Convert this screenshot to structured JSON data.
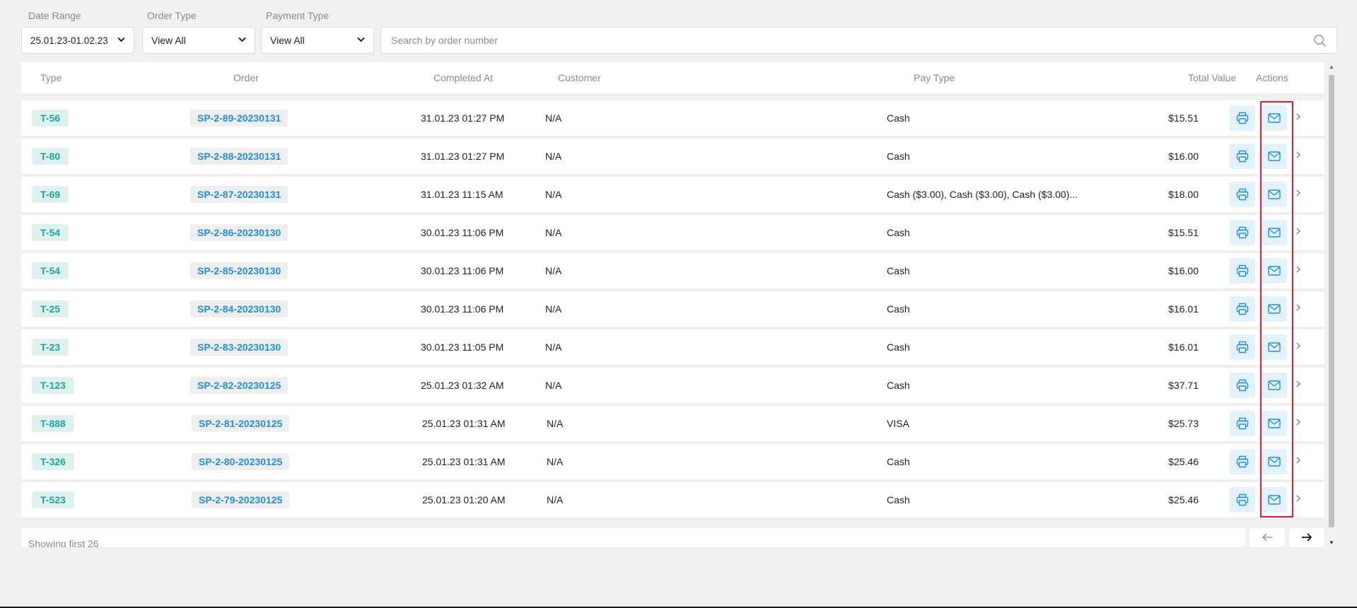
{
  "filters": {
    "date_range": {
      "label": "Date Range",
      "value": "25.01.23-01.02.23"
    },
    "order_type": {
      "label": "Order Type",
      "value": "View All"
    },
    "payment_type": {
      "label": "Payment Type",
      "value": "View All"
    },
    "search": {
      "placeholder": "Search by order number"
    }
  },
  "table": {
    "columns": {
      "type": "Type",
      "order": "Order",
      "completed_at": "Completed At",
      "customer": "Customer",
      "pay_type": "Pay Type",
      "total_value": "Total Value",
      "actions": "Actions"
    },
    "rows": [
      {
        "type": "T-56",
        "order": "SP-2-89-20230131",
        "completed_at": "31.01.23 01:27 PM",
        "customer": "N/A",
        "pay_type": "Cash",
        "total": "$15.51"
      },
      {
        "type": "T-80",
        "order": "SP-2-88-20230131",
        "completed_at": "31.01.23 01:27 PM",
        "customer": "N/A",
        "pay_type": "Cash",
        "total": "$16.00"
      },
      {
        "type": "T-69",
        "order": "SP-2-87-20230131",
        "completed_at": "31.01.23 11:15 AM",
        "customer": "N/A",
        "pay_type": "Cash ($3.00), Cash ($3.00), Cash ($3.00)...",
        "total": "$18.00"
      },
      {
        "type": "T-54",
        "order": "SP-2-86-20230130",
        "completed_at": "30.01.23 11:06 PM",
        "customer": "N/A",
        "pay_type": "Cash",
        "total": "$15.51"
      },
      {
        "type": "T-54",
        "order": "SP-2-85-20230130",
        "completed_at": "30.01.23 11:06 PM",
        "customer": "N/A",
        "pay_type": "Cash",
        "total": "$16.00"
      },
      {
        "type": "T-25",
        "order": "SP-2-84-20230130",
        "completed_at": "30.01.23 11:06 PM",
        "customer": "N/A",
        "pay_type": "Cash",
        "total": "$16.01"
      },
      {
        "type": "T-23",
        "order": "SP-2-83-20230130",
        "completed_at": "30.01.23 11:05 PM",
        "customer": "N/A",
        "pay_type": "Cash",
        "total": "$16.01"
      },
      {
        "type": "T-123",
        "order": "SP-2-82-20230125",
        "completed_at": "25.01.23 01:32 AM",
        "customer": "N/A",
        "pay_type": "Cash",
        "total": "$37.71"
      },
      {
        "type": "T-888",
        "order": "SP-2-81-20230125",
        "completed_at": "25.01.23 01:31 AM",
        "customer": "N/A",
        "pay_type": "VISA",
        "total": "$25.73"
      },
      {
        "type": "T-326",
        "order": "SP-2-80-20230125",
        "completed_at": "25.01.23 01:31 AM",
        "customer": "N/A",
        "pay_type": "Cash",
        "total": "$25.46"
      },
      {
        "type": "T-523",
        "order": "SP-2-79-20230125",
        "completed_at": "25.01.23 01:20 AM",
        "customer": "N/A",
        "pay_type": "Cash",
        "total": "$25.46"
      }
    ]
  },
  "footer": {
    "showing": "Showing first 26"
  },
  "colors": {
    "accent": "#1f8fdc",
    "type_tag": "#19a79b",
    "highlight": "#e21c2c"
  },
  "icons": {
    "print": "printer-icon",
    "email": "mail-icon",
    "row_open": "chevron-right-icon",
    "search": "search-icon"
  }
}
